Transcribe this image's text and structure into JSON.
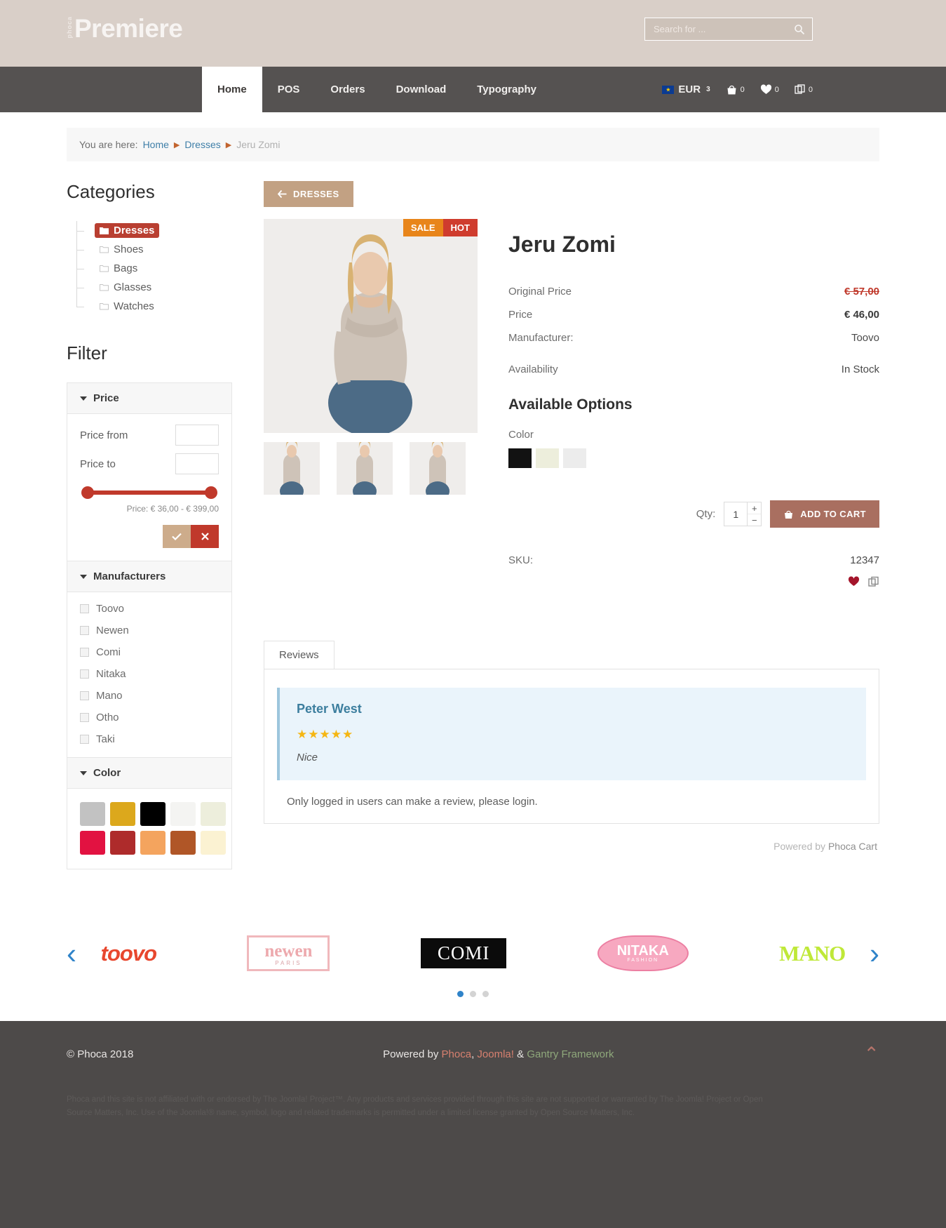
{
  "header": {
    "logo_mini": "phoca",
    "logo_main": "Premiere",
    "search_placeholder": "Search for ...",
    "search_value": "",
    "search_icon": "search-icon"
  },
  "nav": {
    "items": [
      {
        "label": "Home",
        "active": true
      },
      {
        "label": "POS",
        "active": false
      },
      {
        "label": "Orders",
        "active": false
      },
      {
        "label": "Download",
        "active": false
      },
      {
        "label": "Typography",
        "active": false
      }
    ],
    "currency": "EUR",
    "currency_count": "3",
    "cart_count": "0",
    "wishlist_count": "0",
    "compare_count": "0"
  },
  "breadcrumb": {
    "prefix": "You are here:",
    "items": [
      "Home",
      "Dresses"
    ],
    "current": "Jeru Zomi"
  },
  "sidebar": {
    "categories_title": "Categories",
    "categories": [
      {
        "label": "Dresses",
        "active": true
      },
      {
        "label": "Shoes",
        "active": false
      },
      {
        "label": "Bags",
        "active": false
      },
      {
        "label": "Glasses",
        "active": false
      },
      {
        "label": "Watches",
        "active": false
      }
    ],
    "filter_title": "Filter",
    "price_panel": {
      "title": "Price",
      "from_label": "Price from",
      "to_label": "Price to",
      "from_value": "",
      "to_value": "",
      "range_label": "Price: € 36,00 - € 399,00",
      "apply_icon": "check-icon",
      "clear_icon": "cross-icon"
    },
    "manufacturers_panel": {
      "title": "Manufacturers",
      "items": [
        "Toovo",
        "Newen",
        "Comi",
        "Nitaka",
        "Mano",
        "Otho",
        "Taki"
      ]
    },
    "color_panel": {
      "title": "Color",
      "swatches": [
        "#c2c2c2",
        "#dca81c",
        "#000000",
        "#f4f4f2",
        "#edeedc",
        "#e21241",
        "#ae2b2b",
        "#f4a45e",
        "#b05627",
        "#fbf2d2"
      ]
    }
  },
  "product": {
    "back_label": "DRESSES",
    "back_icon": "arrow-left-icon",
    "badges": [
      {
        "label": "SALE",
        "color": "#e8851a"
      },
      {
        "label": "HOT",
        "color": "#cf3c2e"
      }
    ],
    "name": "Jeru Zomi",
    "specs": [
      {
        "key": "Original Price",
        "value": "€ 57,00",
        "style": "old"
      },
      {
        "key": "Price",
        "value": "€ 46,00",
        "style": "now"
      },
      {
        "key": "Manufacturer:",
        "value": "Toovo",
        "style": "plain"
      },
      {
        "key": "Availability",
        "value": "In Stock",
        "style": "plain"
      }
    ],
    "options_title": "Available Options",
    "color_label": "Color",
    "color_options": [
      "#121212",
      "#edeedc",
      "#ececec"
    ],
    "qty_label": "Qty:",
    "qty_value": "1",
    "plus": "+",
    "minus": "−",
    "add_to_cart": "ADD TO CART",
    "cart_icon": "bag-icon",
    "sku_label": "SKU:",
    "sku_value": "12347",
    "wishlist_icon": "heart-icon",
    "compare_icon": "compare-icon"
  },
  "reviews": {
    "tab_label": "Reviews",
    "entries": [
      {
        "author": "Peter West",
        "stars": "★★★★★",
        "text": "Nice"
      }
    ],
    "login_note": "Only logged in users can make a review, please login.",
    "powered_prefix": "Powered by",
    "powered_name": "Phoca Cart"
  },
  "brands": {
    "prev_icon": "chevron-left-icon",
    "next_icon": "chevron-right-icon",
    "items": [
      {
        "name": "toovo"
      },
      {
        "name": "newen",
        "sub": "PARIS"
      },
      {
        "name": "COMI"
      },
      {
        "name": "NITAKA",
        "sub": "FASHION"
      },
      {
        "name": "MANO"
      }
    ],
    "dots": [
      true,
      false,
      false
    ]
  },
  "footer": {
    "copyright": "© Phoca 2018",
    "powered_by": "Powered by",
    "links": [
      {
        "label": "Phoca",
        "cls": "phoca"
      },
      {
        "label": "Joomla!",
        "cls": "joomla"
      },
      {
        "label": "Gantry Framework",
        "cls": "gantry"
      }
    ],
    "amp": "&",
    "scroll_top_icon": "chevron-up-icon",
    "legal": "Phoca and this site is not affiliated with or endorsed by The Joomla! Project™. Any products and services provided through this site are not supported or warranted by The Joomla! Project or Open Source Matters, Inc. Use of the Joomla!® name, symbol, logo and related trademarks is permitted under a limited license granted by Open Source Matters, Inc."
  }
}
